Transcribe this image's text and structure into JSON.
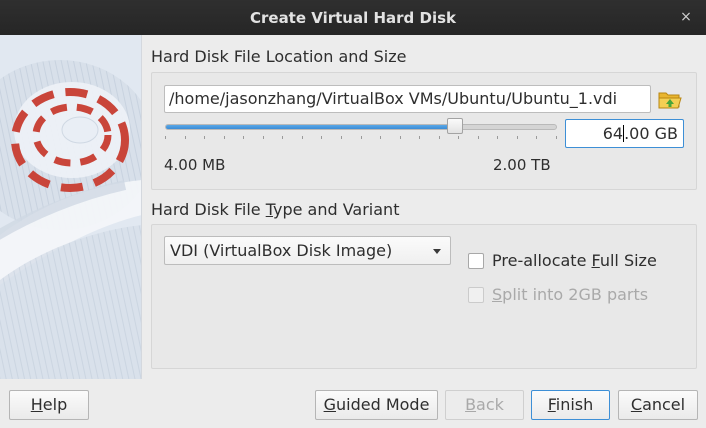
{
  "window": {
    "title": "Create Virtual Hard Disk",
    "close_glyph": "×"
  },
  "location": {
    "title_pre": "Hard Disk File Location and Size",
    "file_path": "/home/jasonzhang/VirtualBox VMs/Ubuntu/Ubuntu_1.vdi",
    "folder_icon": "folder-open-icon",
    "size_value": "64.00 GB",
    "slider_min_label": "4.00 MB",
    "slider_max_label": "2.00 TB",
    "slider_fraction": 0.74
  },
  "type": {
    "title_pre": "Hard Disk File ",
    "title_u": "T",
    "title_post": "ype and Variant",
    "format_selected": "VDI (VirtualBox Disk Image)",
    "preallocate": {
      "pre": "Pre-allocate ",
      "u": "F",
      "post": "ull Size",
      "checked": false
    },
    "split": {
      "pre": "",
      "u": "S",
      "post": "plit into 2GB parts",
      "checked": false,
      "disabled": true
    }
  },
  "buttons": {
    "help": {
      "u": "H",
      "rest": "elp"
    },
    "guided": {
      "u": "G",
      "rest": "uided Mode"
    },
    "back": {
      "u": "B",
      "rest": "ack"
    },
    "finish": {
      "u": "F",
      "rest": "inish"
    },
    "cancel": {
      "u": "C",
      "rest": "ancel"
    }
  },
  "colors": {
    "titlebar": "#2b2b2b",
    "accent": "#3d8fd6",
    "art_red": "#c9453a",
    "art_bg": "#e1e8f1"
  }
}
